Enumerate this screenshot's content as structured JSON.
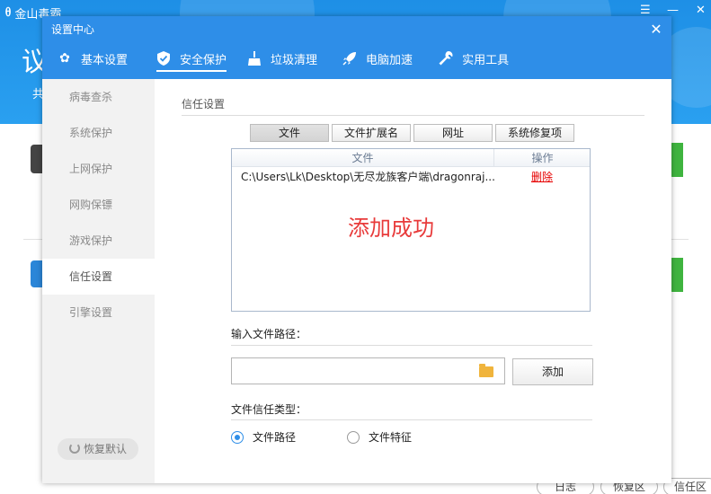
{
  "app": {
    "name": "金山毒霸",
    "header_big": "议",
    "header_small": "共",
    "win_controls": {
      "menu": "☰",
      "minimize": "—",
      "close": "✕"
    },
    "bottom_buttons": [
      "日志",
      "恢复区",
      "信任区"
    ]
  },
  "dialog": {
    "title": "设置中心",
    "close": "✕",
    "tabs": [
      {
        "label": "基本设置",
        "icon": "gear-icon"
      },
      {
        "label": "安全保护",
        "icon": "shield-icon"
      },
      {
        "label": "垃圾清理",
        "icon": "broom-icon"
      },
      {
        "label": "电脑加速",
        "icon": "rocket-icon"
      },
      {
        "label": "实用工具",
        "icon": "wrench-icon"
      }
    ],
    "active_tab": "安全保护",
    "sidebar": {
      "items": [
        "病毒查杀",
        "系统保护",
        "上网保护",
        "网购保镖",
        "游戏保护",
        "信任设置",
        "引擎设置"
      ],
      "active": "信任设置",
      "restore_label": "恢复默认"
    },
    "content": {
      "section_title": "信任设置",
      "subtabs": [
        "文件",
        "文件扩展名",
        "网址",
        "系统修复项"
      ],
      "active_subtab": "文件",
      "list": {
        "col_file": "文件",
        "col_op": "操作",
        "rows": [
          {
            "path": "C:\\Users\\Lk\\Desktop\\无尽龙族客户端\\dragonraj...",
            "action": "删除"
          }
        ]
      },
      "success_message": "添加成功",
      "path_label": "输入文件路径：",
      "path_value": "",
      "add_label": "添加",
      "type_label": "文件信任类型：",
      "radio_options": [
        "文件路径",
        "文件特征"
      ],
      "radio_selected": "文件路径"
    }
  },
  "colors": {
    "accent": "#2e8ee8",
    "success_text": "#e83b3b",
    "delete_link": "#e60000",
    "sidebar_bg": "#f2f2f2"
  }
}
